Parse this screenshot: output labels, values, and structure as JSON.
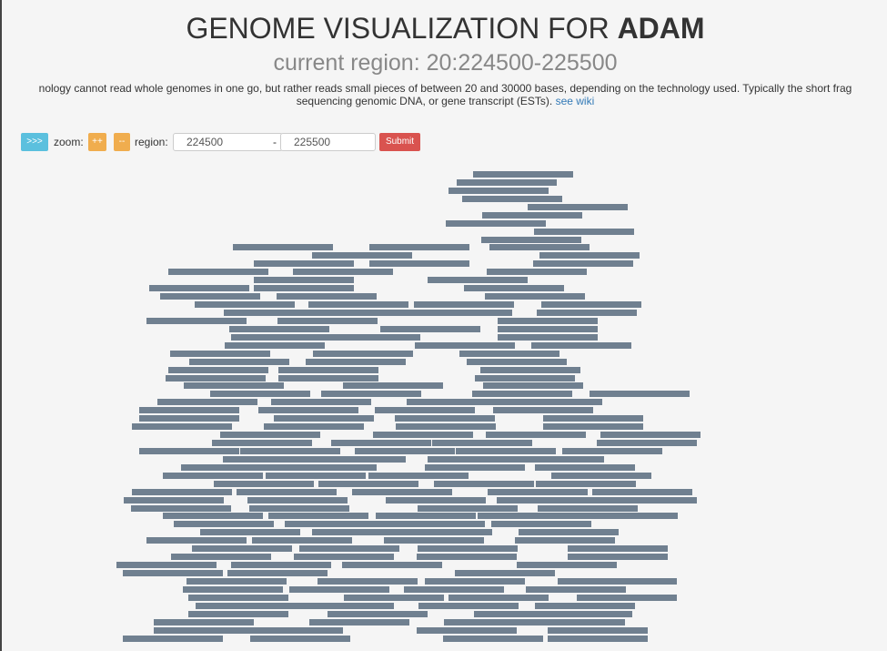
{
  "header": {
    "title_prefix": "GENOME VISUALIZATION FOR ",
    "title_name": "ADAM",
    "subtitle": "current region: 20:224500-225500"
  },
  "description": {
    "line1": "nology cannot read whole genomes in one go, but rather reads small pieces of between 20 and 30000 bases, depending on the technology used. Typically the short frag",
    "line2": "sequencing genomic DNA, or gene transcript (ESTs).",
    "link": "see wiki"
  },
  "controls": {
    "next_label": ">>>",
    "zoom_label": "zoom:",
    "zoom_in_label": "++",
    "zoom_out_label": "--",
    "region_label": "region:",
    "start_value": "224500",
    "dash": "-",
    "end_value": "225500",
    "submit_label": "Submit"
  },
  "colors": {
    "read": "#708090",
    "next_button": "#5bc0de",
    "zoom_buttons": "#f0ad4e",
    "submit_button": "#d9534f"
  }
}
